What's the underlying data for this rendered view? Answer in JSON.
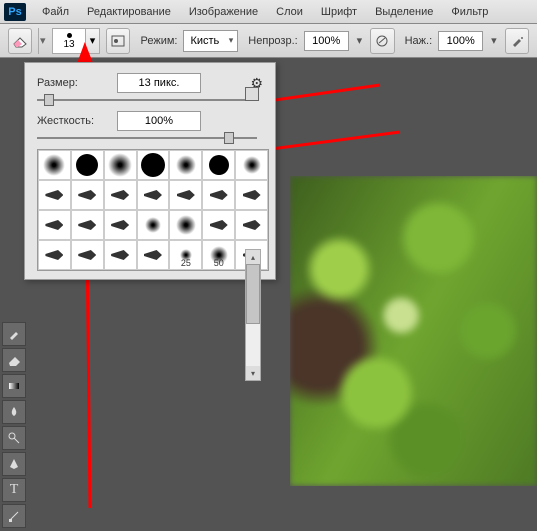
{
  "menu": {
    "items": [
      "Файл",
      "Редактирование",
      "Изображение",
      "Слои",
      "Шрифт",
      "Выделение",
      "Фильтр"
    ]
  },
  "logo": "Ps",
  "optbar": {
    "brush_size_preview": "13",
    "mode_label": "Режим:",
    "mode_value": "Кисть",
    "opacity_label": "Непрозр.:",
    "opacity_value": "100%",
    "flow_label": "Наж.:",
    "flow_value": "100%"
  },
  "popup": {
    "size_label": "Размер:",
    "size_value": "13 пикс.",
    "hardness_label": "Жесткость:",
    "hardness_value": "100%",
    "brush_sizes": [
      "",
      "",
      "",
      "",
      "",
      "",
      "",
      "",
      "",
      "",
      "",
      "",
      "",
      "",
      "",
      "",
      "",
      "",
      "",
      "",
      "",
      "",
      "",
      "",
      "",
      "25",
      "50",
      ""
    ]
  }
}
